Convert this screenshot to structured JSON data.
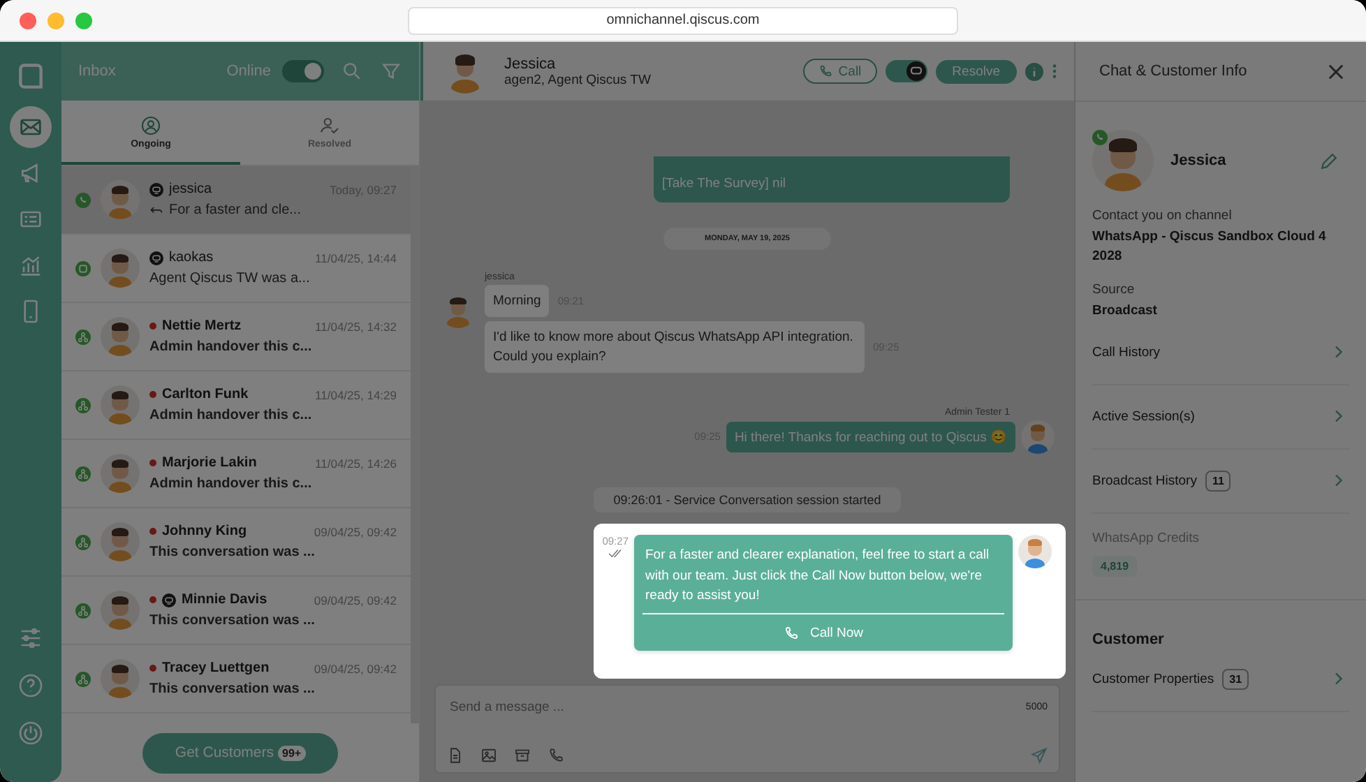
{
  "window": {
    "url": "omnichannel.qiscus.com"
  },
  "nav_top": [
    {
      "kind": "inbox",
      "selected": true
    },
    {
      "kind": "megaphone",
      "selected": false
    },
    {
      "kind": "contact-card",
      "selected": false
    },
    {
      "kind": "chart",
      "selected": false
    },
    {
      "kind": "phone",
      "selected": false
    }
  ],
  "nav_bottom": [
    {
      "kind": "sliders",
      "selected": false
    },
    {
      "kind": "help",
      "selected": false
    },
    {
      "kind": "power",
      "selected": false
    }
  ],
  "inbox": {
    "title": "Inbox",
    "status_label": "Online",
    "online": true
  },
  "tabs": [
    {
      "label": "Ongoing",
      "kind": "person",
      "selected": true
    },
    {
      "label": "Resolved",
      "kind": "person-check",
      "selected": false
    }
  ],
  "conversations": [
    {
      "name": "jessica",
      "time": "Today, 09:27",
      "preview": "For a faster and cle...",
      "kind": "whatsapp",
      "bot": true,
      "replied": true,
      "unread": false,
      "selected": true
    },
    {
      "name": "kaokas",
      "time": "11/04/25, 14:44",
      "preview": "Agent Qiscus TW was a...",
      "kind": "qiscus",
      "bot": true,
      "replied": false,
      "unread": false,
      "selected": false
    },
    {
      "name": "Nettie Mertz",
      "time": "11/04/25, 14:32",
      "preview": "Admin handover this c...",
      "kind": "web",
      "bot": false,
      "replied": false,
      "unread": true,
      "selected": false
    },
    {
      "name": "Carlton Funk",
      "time": "11/04/25, 14:29",
      "preview": "Admin handover this c...",
      "kind": "web",
      "bot": false,
      "replied": false,
      "unread": true,
      "selected": false
    },
    {
      "name": "Marjorie Lakin",
      "time": "11/04/25, 14:26",
      "preview": "Admin handover this c...",
      "kind": "web",
      "bot": false,
      "replied": false,
      "unread": true,
      "selected": false
    },
    {
      "name": "Johnny King",
      "time": "09/04/25, 09:42",
      "preview": "This conversation was ...",
      "kind": "web",
      "bot": false,
      "replied": false,
      "unread": true,
      "selected": false
    },
    {
      "name": "Minnie Davis",
      "time": "09/04/25, 09:42",
      "preview": "This conversation was ...",
      "kind": "web",
      "bot": true,
      "replied": false,
      "unread": true,
      "selected": false
    },
    {
      "name": "Tracey Luettgen",
      "time": "09/04/25, 09:42",
      "preview": "This conversation was ...",
      "kind": "web",
      "bot": false,
      "replied": false,
      "unread": true,
      "selected": false
    }
  ],
  "get_customers": {
    "label": "Get Customers",
    "count": "99+"
  },
  "chat_header": {
    "name": "Jessica",
    "subtitle": "agen2, Agent Qiscus TW",
    "call_label": "Call",
    "bot_on": true,
    "resolve_label": "Resolve"
  },
  "messages": [
    {
      "kind": "out_plain",
      "text": "[Take The Survey] nil"
    },
    {
      "kind": "date",
      "text": "MONDAY, MAY 19, 2025"
    },
    {
      "kind": "in",
      "sender": "jessica",
      "bubbles": [
        {
          "text": "Morning",
          "time": "09:21"
        },
        {
          "text": "I'd like to know more about Qiscus WhatsApp API integration. Could you explain?",
          "time": "09:25"
        }
      ]
    },
    {
      "kind": "out",
      "sender": "Admin Tester 1",
      "text": "Hi there! Thanks for reaching out to Qiscus 😊",
      "time": "09:25"
    },
    {
      "kind": "system",
      "text": "09:26:01 - Service Conversation session started"
    },
    {
      "kind": "call_cta",
      "highlighted": true,
      "time": "09:27",
      "text": "For a faster and clearer explanation, feel free to start a call with our team. Just click the Call Now button below, we're ready to assist you!",
      "button": "Call Now"
    }
  ],
  "composer": {
    "placeholder": "Send a message ...",
    "counter": "5000"
  },
  "info": {
    "title": "Chat & Customer Info",
    "name": "Jessica",
    "fields": [
      {
        "label": "Contact you on channel",
        "value": "WhatsApp - Qiscus Sandbox Cloud 4 2028"
      },
      {
        "label": "Source",
        "value": "Broadcast"
      }
    ],
    "links": [
      {
        "label": "Call History"
      },
      {
        "label": "Active Session(s)"
      },
      {
        "label": "Broadcast History",
        "count": "11"
      }
    ],
    "credits": {
      "label": "WhatsApp Credits",
      "value": "4,819"
    },
    "section": "Customer",
    "customer_links": [
      {
        "label": "Customer Properties",
        "count": "31"
      }
    ]
  }
}
